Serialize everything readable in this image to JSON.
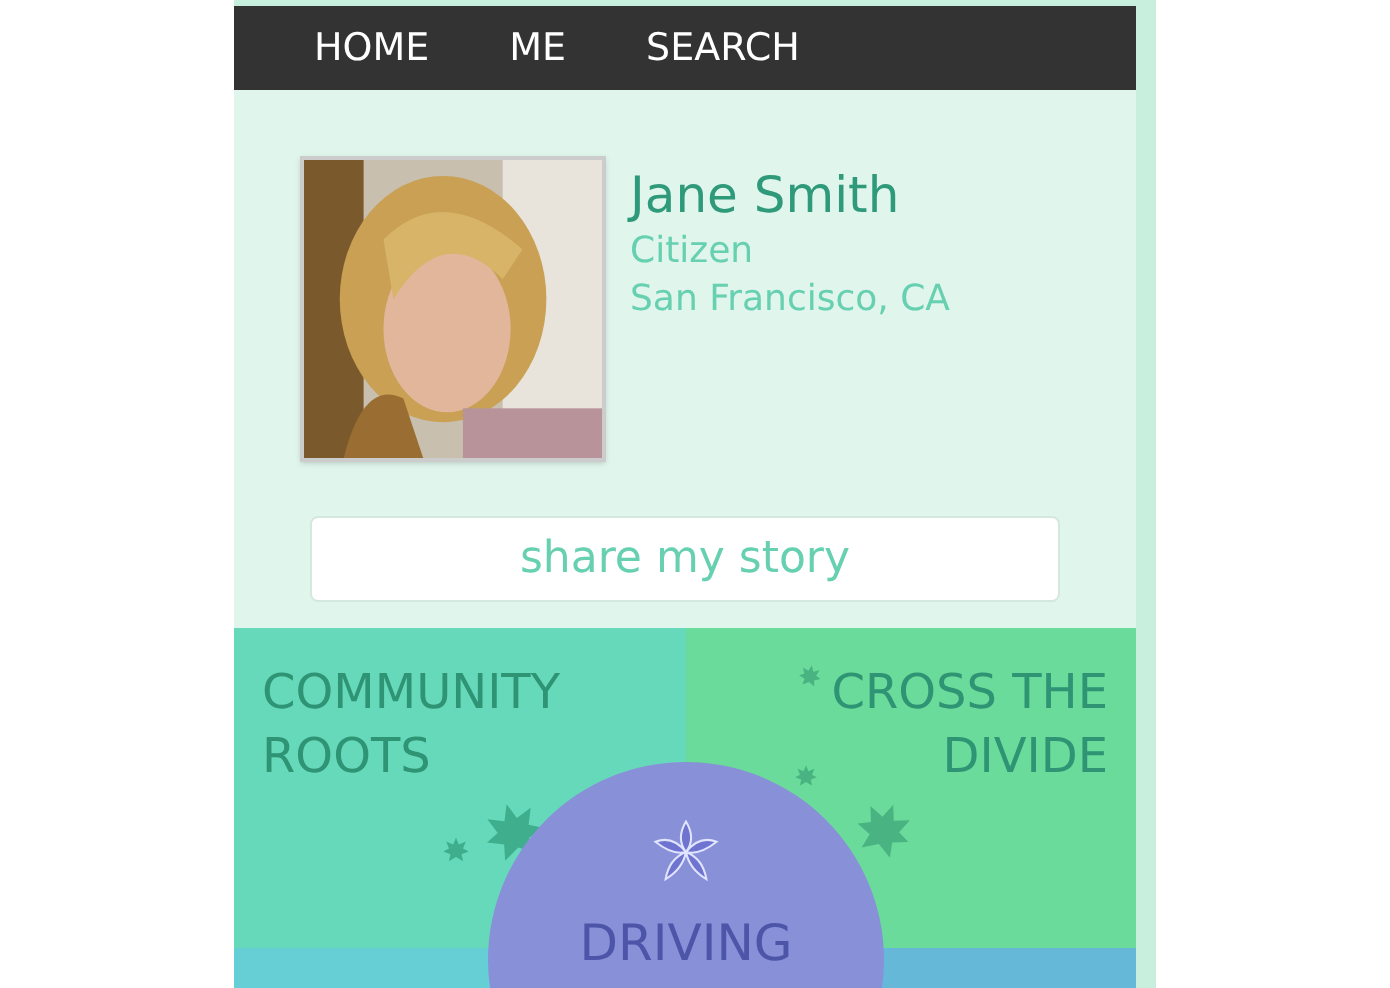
{
  "nav": {
    "items": [
      {
        "label": "HOME"
      },
      {
        "label": "ME"
      },
      {
        "label": "SEARCH"
      }
    ]
  },
  "profile": {
    "name": "Jane Smith",
    "role": "Citizen",
    "location": "San Francisco, CA"
  },
  "share_button": {
    "label": "share my story"
  },
  "tiles": [
    {
      "label": "COMMUNITY ROOTS"
    },
    {
      "label": "CROSS THE DIVIDE"
    }
  ],
  "center_circle": {
    "label": "DRIVING"
  }
}
